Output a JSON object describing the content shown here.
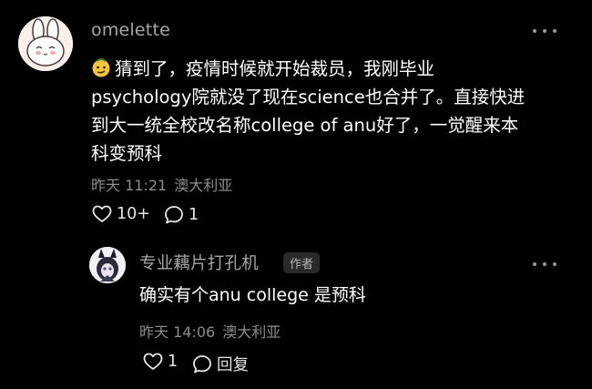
{
  "main_comment": {
    "username": "omelette",
    "emoji": "smirk-face-emoji",
    "lines": [
      "猜到了，疫情时候就开始裁员，我刚毕业",
      "psychology院就没了现在science也合并了。直接快进",
      "到大一统全校改名称college of anu好了，一觉醒来本",
      "科变预科"
    ],
    "timestamp": "昨天 11:21",
    "location": "澳大利亚",
    "like_count": "10+",
    "reply_count": "1"
  },
  "reply": {
    "username": "专业藕片打孔机",
    "author_badge": "作者",
    "text": "确实有个anu college 是预科",
    "timestamp": "昨天 14:06",
    "location": "澳大利亚",
    "like_count": "1",
    "reply_label": "回复"
  },
  "colors": {
    "background": "#000000",
    "username": "#a7a7a7",
    "meta": "#8d8d8d",
    "body": "#ffffff"
  }
}
